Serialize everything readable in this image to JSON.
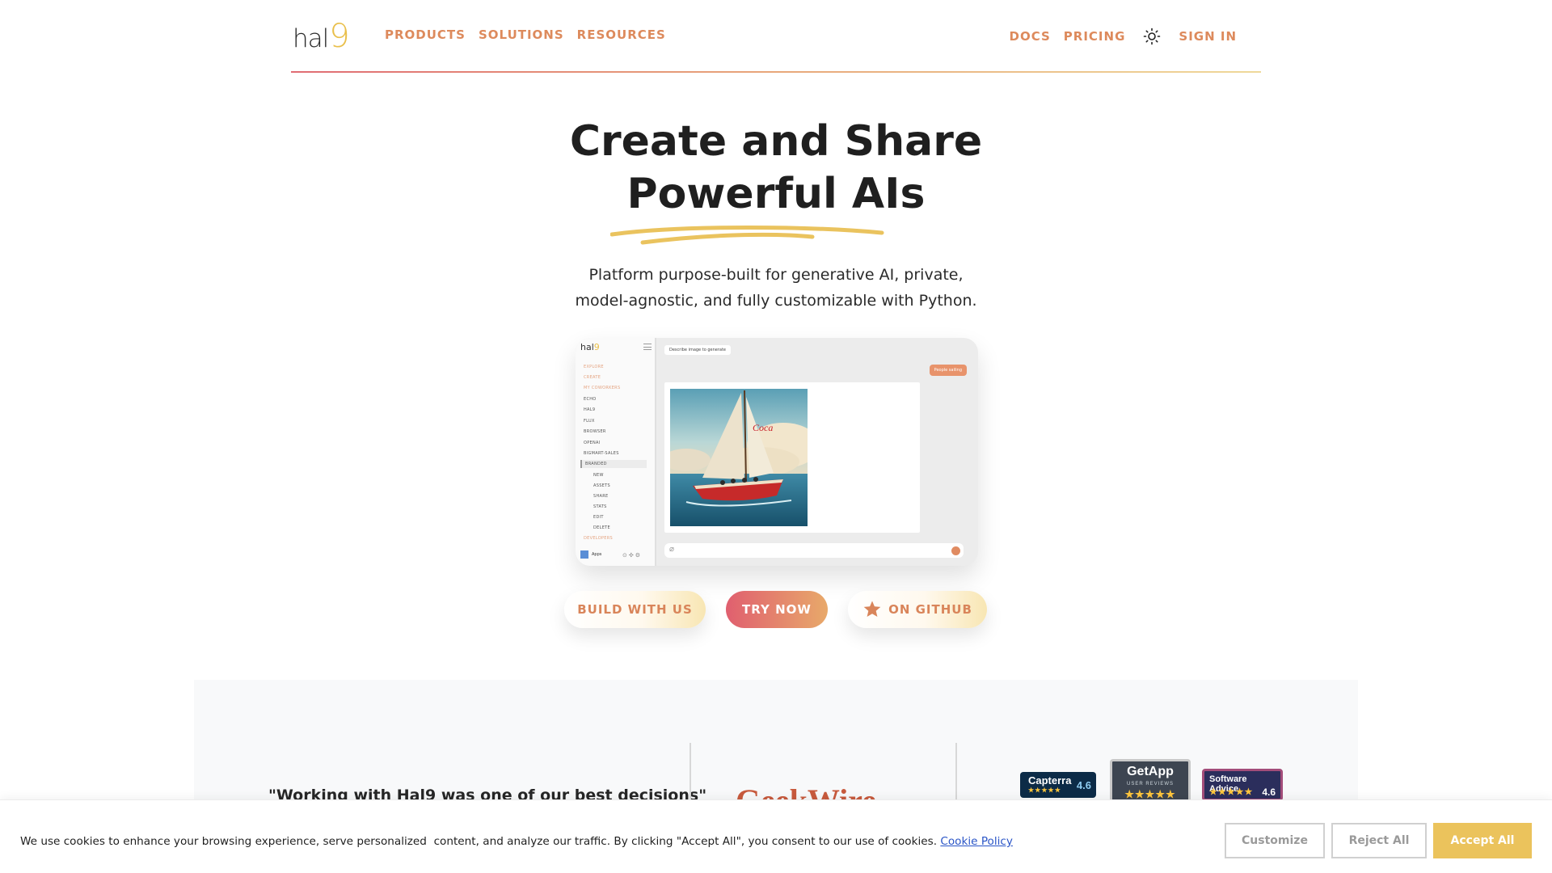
{
  "nav": {
    "logo_text": "hal",
    "logo_mark": "9",
    "links_left": [
      "PRODUCTS",
      "SOLUTIONS",
      "RESOURCES"
    ],
    "links_right": [
      "DOCS",
      "PRICING"
    ],
    "theme_icon": "sun-icon",
    "sign_in": "SIGN IN"
  },
  "hero": {
    "title_line1": "Create and Share",
    "title_line2": "Powerful AIs",
    "subtitle": "Platform purpose-built for generative AI, private, model-agnostic, and fully customizable with Python."
  },
  "preview": {
    "logo_text": "hal",
    "logo_mark": "9",
    "sidebar": {
      "explore": "EXPLORE",
      "create": "CREATE",
      "my_coworkers": "MY COWORKERS",
      "apps": [
        "ECHO",
        "HAL9",
        "FLUX",
        "BROWSER",
        "OPENAI",
        "BIGMART-SALES",
        "BRANDED"
      ],
      "sub_items": [
        "NEW",
        "ASSETS",
        "SHARE",
        "STATS",
        "EDIT",
        "DELETE"
      ],
      "developers": "DEVELOPERS",
      "footer_apps": "Apps"
    },
    "prompt": "Describe image to generate",
    "pill": "People sailing"
  },
  "buttons": {
    "build": "BUILD WITH US",
    "try": "TRY NOW",
    "github": "ON GITHUB"
  },
  "proof": {
    "quote": "\"Working with Hal9 was one of our best decisions\"",
    "press_logo": "GeekWire",
    "badges": {
      "capterra": {
        "name": "Capterra",
        "score": "4.6"
      },
      "getapp": {
        "name": "GetApp",
        "sub": "USER REVIEWS"
      },
      "software_advice": {
        "name": "Software Advice.",
        "score": "4.6"
      }
    }
  },
  "cookie": {
    "text": "We use cookies to enhance your browsing experience, serve personalized  content, and analyze our traffic. By clicking \"Accept All\", you consent to our use of cookies. ",
    "link": "Cookie Policy",
    "customize": "Customize",
    "reject": "Reject All",
    "accept": "Accept All"
  },
  "colors": {
    "accent_orange": "#dd8a5c",
    "accent_yellow": "#ebc35c",
    "accent_red": "#e05f6f",
    "link_blue": "#2a55c7"
  }
}
